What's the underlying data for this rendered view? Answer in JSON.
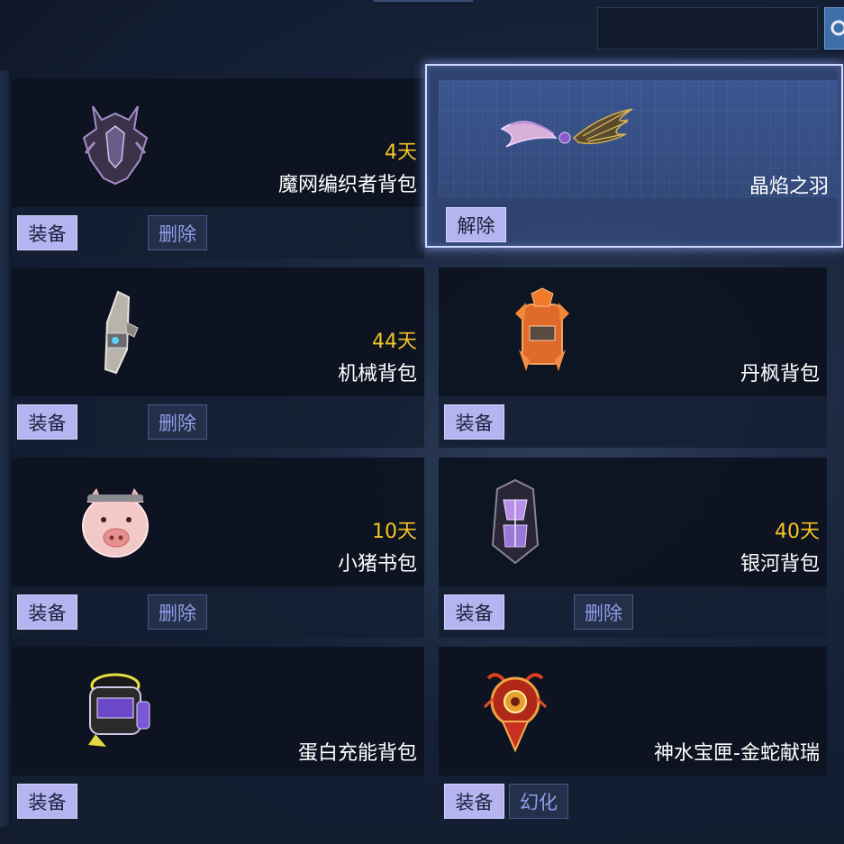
{
  "search": {
    "placeholder": "",
    "value": ""
  },
  "items": [
    {
      "name": "魔网编织者背包",
      "days": "4天",
      "primary": "装备",
      "secondary": "删除",
      "icon": "dark-spiked-backpack-icon",
      "selected": false
    },
    {
      "name": "晶焰之羽",
      "days": "",
      "primary": "解除",
      "secondary": "",
      "icon": "crystal-flame-wings-icon",
      "selected": true
    },
    {
      "name": "机械背包",
      "days": "44天",
      "primary": "装备",
      "secondary": "删除",
      "icon": "mechanical-backpack-icon",
      "selected": false
    },
    {
      "name": "丹枫背包",
      "days": "",
      "primary": "装备",
      "secondary": "",
      "icon": "maple-leaf-backpack-icon",
      "selected": false
    },
    {
      "name": "小猪书包",
      "days": "10天",
      "primary": "装备",
      "secondary": "删除",
      "icon": "piggy-backpack-icon",
      "selected": false
    },
    {
      "name": "银河背包",
      "days": "40天",
      "primary": "装备",
      "secondary": "删除",
      "icon": "galaxy-backpack-icon",
      "selected": false
    },
    {
      "name": "蛋白充能背包",
      "days": "",
      "primary": "装备",
      "secondary": "",
      "icon": "protein-charge-backpack-icon",
      "selected": false
    },
    {
      "name": "神水宝匣-金蛇献瑞",
      "days": "",
      "primary": "装备",
      "secondary": "幻化",
      "icon": "golden-snake-chest-icon",
      "selected": false
    }
  ],
  "colors": {
    "days": "#f5c424",
    "primary_button": "#b5b4f0",
    "secondary_button_text": "#8e9ee8",
    "selected_border": "#cfd8ff"
  }
}
